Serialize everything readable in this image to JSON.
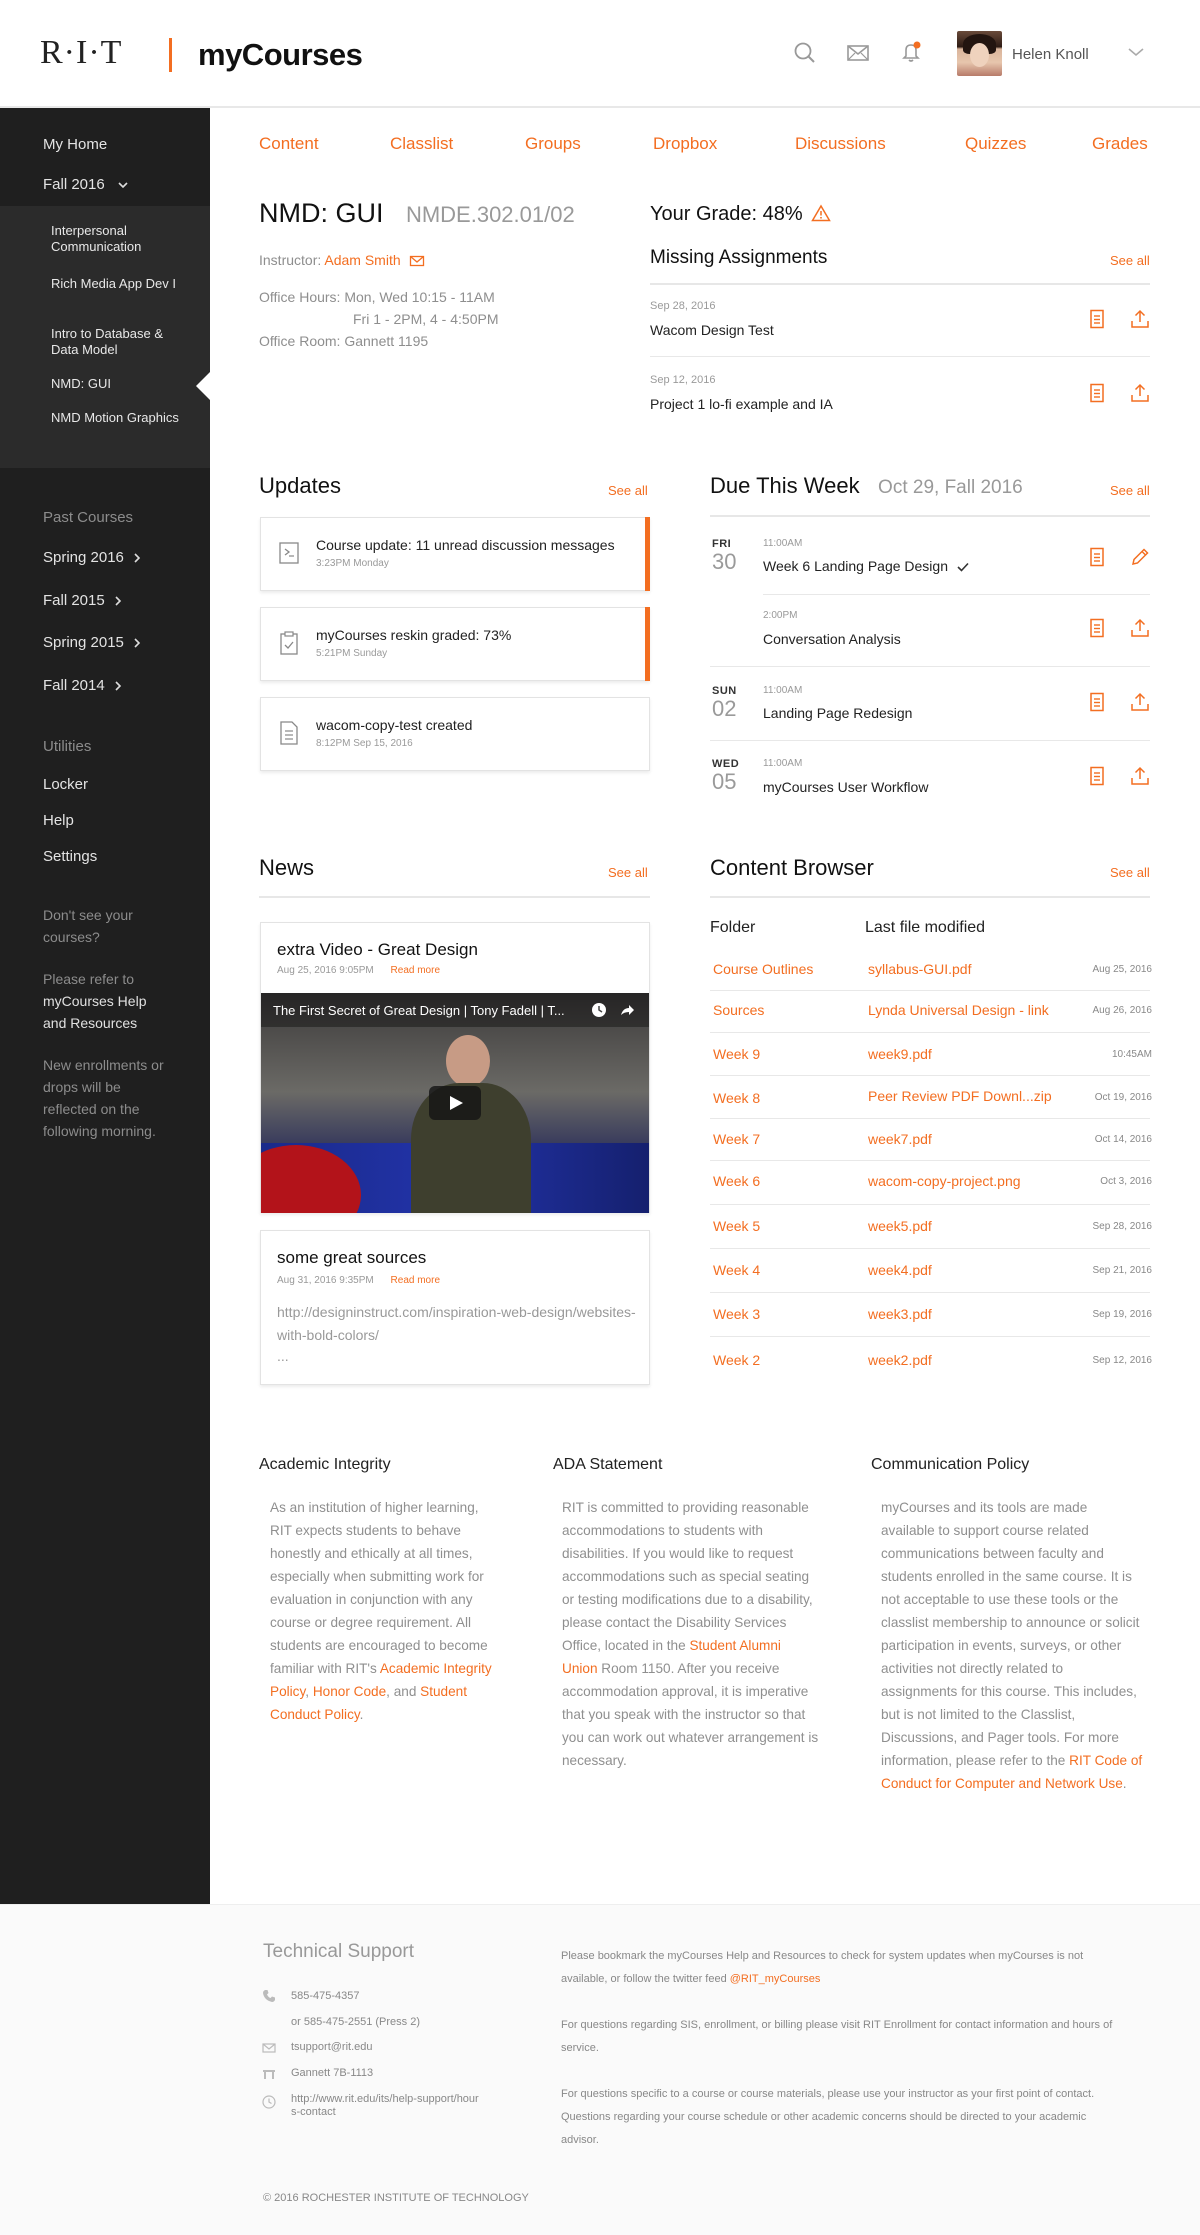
{
  "header": {
    "logo": "R·I·T",
    "site_name": "myCourses",
    "user_name": "Helen Knoll"
  },
  "sidebar": {
    "my_home": "My Home",
    "term": "Fall 2016",
    "courses": [
      "Interpersonal Communication",
      "Rich Media App Dev I",
      "Intro to Database & Data Model",
      "NMD: GUI",
      "NMD Motion Graphics"
    ],
    "past_heading": "Past Courses",
    "past": [
      "Spring 2016",
      "Fall 2015",
      "Spring 2015",
      "Fall 2014"
    ],
    "utilities_heading": "Utilities",
    "utilities": [
      "Locker",
      "Help",
      "Settings"
    ],
    "note1": "Don't see your courses?",
    "note2a": "Please refer to",
    "note2b": "myCourses Help and Resources",
    "note3": "New enrollments or drops will be reflected on the following morning."
  },
  "tabs": [
    "Content",
    "Classlist",
    "Groups",
    "Dropbox",
    "Discussions",
    "Quizzes",
    "Grades"
  ],
  "course": {
    "title": "NMD: GUI",
    "code": "NMDE.302.01/02",
    "instructor_label": "Instructor:",
    "instructor": "Adam Smith",
    "hours_label": "Office Hours:",
    "hours1": "Mon, Wed 10:15 - 11AM",
    "hours2": "Fri 1 - 2PM, 4 - 4:50PM",
    "room": "Office Room: Gannett 1195"
  },
  "grade": {
    "label": "Your Grade: 48%"
  },
  "missing": {
    "title": "Missing Assignments",
    "see_all": "See all",
    "items": [
      {
        "date": "Sep 28, 2016",
        "title": "Wacom Design Test"
      },
      {
        "date": "Sep 12, 2016",
        "title": "Project 1 lo-fi example and IA"
      }
    ]
  },
  "updates": {
    "title": "Updates",
    "see_all": "See all",
    "items": [
      {
        "title": "Course update: 11 unread discussion messages",
        "time": "3:23PM Monday"
      },
      {
        "title": "myCourses reskin graded: 73%",
        "time": "5:21PM Sunday"
      },
      {
        "title": "wacom-copy-test created",
        "time": "8:12PM Sep 15, 2016"
      }
    ]
  },
  "due": {
    "title": "Due This Week",
    "subtitle": "Oct 29, Fall 2016",
    "see_all": "See all",
    "items": [
      {
        "day": "FRI",
        "date": "30",
        "time": "11:00AM",
        "title": "Week 6 Landing Page Design"
      },
      {
        "day": "",
        "date": "",
        "time": "2:00PM",
        "title": "Conversation Analysis"
      },
      {
        "day": "SUN",
        "date": "02",
        "time": "11:00AM",
        "title": "Landing Page Redesign"
      },
      {
        "day": "WED",
        "date": "05",
        "time": "11:00AM",
        "title": "myCourses User Workflow"
      }
    ]
  },
  "news": {
    "title": "News",
    "see_all": "See all",
    "items": [
      {
        "title": "extra Video - Great Design",
        "date": "Aug 25, 2016 9:05PM",
        "read_more": "Read more",
        "video_title": "The First Secret of Great Design | Tony Fadell | T..."
      },
      {
        "title": "some great sources",
        "date": "Aug 31, 2016 9:35PM",
        "read_more": "Read more",
        "body": "http://designinstruct.com/inspiration-web-design/websites-with-bold-colors/",
        "ellipsis": "..."
      }
    ]
  },
  "content_browser": {
    "title": "Content Browser",
    "see_all": "See all",
    "col_folder": "Folder",
    "col_file": "Last file modified",
    "rows": [
      {
        "folder": "Course Outlines",
        "file": "syllabus-GUI.pdf",
        "date": "Aug 25, 2016"
      },
      {
        "folder": "Sources",
        "file": "Lynda Universal Design - link",
        "date": "Aug 26, 2016"
      },
      {
        "folder": "Week 9",
        "file": "week9.pdf",
        "date": "10:45AM"
      },
      {
        "folder": "Week 8",
        "file": "Peer Review PDF Downl...zip",
        "date": "Oct 19, 2016"
      },
      {
        "folder": "Week 7",
        "file": "week7.pdf",
        "date": "Oct 14, 2016"
      },
      {
        "folder": "Week 6",
        "file": "wacom-copy-project.png",
        "date": "Oct 3, 2016"
      },
      {
        "folder": "Week 5",
        "file": "week5.pdf",
        "date": "Sep 28, 2016"
      },
      {
        "folder": "Week 4",
        "file": "week4.pdf",
        "date": "Sep 21, 2016"
      },
      {
        "folder": "Week 3",
        "file": "week3.pdf",
        "date": "Sep 19, 2016"
      },
      {
        "folder": "Week 2",
        "file": "week2.pdf",
        "date": "Sep 12, 2016"
      }
    ]
  },
  "policies": {
    "academic": {
      "title": "Academic Integrity",
      "text": "As an institution of higher learning, RIT expects students to behave honestly and ethically at all times, especially when submitting work for evaluation in conjunction with any course or degree requirement. All students are encouraged to become familiar with RIT's ",
      "link1": "Academic Integrity Policy",
      "sep1": ", ",
      "link2": "Honor Code",
      "sep2": ", and ",
      "link3": "Student Conduct Policy",
      "end": "."
    },
    "ada": {
      "title": "ADA Statement",
      "text": "RIT is committed to providing reasonable accommodations to students with disabilities. If you would like to request accommodations such as special seating or testing modifications due to a disability, please contact the Disability Services Office, located in the ",
      "link": "Student Alumni Union",
      "text2": " Room 1150. After you receive accommodation approval, it is imperative that you speak with the instructor so that you can work out whatever arrangement is necessary."
    },
    "comm": {
      "title": "Communication Policy",
      "text": "myCourses and its tools are made available to support course related communications between faculty and students enrolled in the same course. It is not acceptable to use these tools or the classlist membership to announce or solicit participation in events, surveys, or other activities not directly related to assignments for this course. This includes, but is not limited to the Classlist, Discussions, and Pager tools. For more information, please refer to the ",
      "link": "RIT Code of Conduct for Computer and Network Use",
      "end": "."
    }
  },
  "footer": {
    "support_title": "Technical Support",
    "phone1": "585-475-4357",
    "phone2": "or 585-475-2551 (Press 2)",
    "email": "tsupport@rit.edu",
    "location": "Gannett 7B-1113",
    "url": "http://www.rit.edu/its/help-support/hours-contact",
    "p1": "Please bookmark the myCourses Help and Resources to check for system updates when myCourses is not available, or follow the twitter feed ",
    "p1_link": "@RIT_myCourses",
    "p2": "For questions regarding SIS, enrollment, or billing please visit RIT Enrollment for contact information and hours of service.",
    "p3": "For questions specific to a course or course materials, please use your instructor as your first point of contact. Questions regarding your course schedule or other academic concerns should be directed to your academic advisor.",
    "copyright": "© 2016 ROCHESTER INSTITUTE OF TECHNOLOGY"
  },
  "colors": {
    "accent": "#f36e21",
    "sidebar": "#1f1f1f",
    "sidebar_panel": "#2b2b2b"
  }
}
